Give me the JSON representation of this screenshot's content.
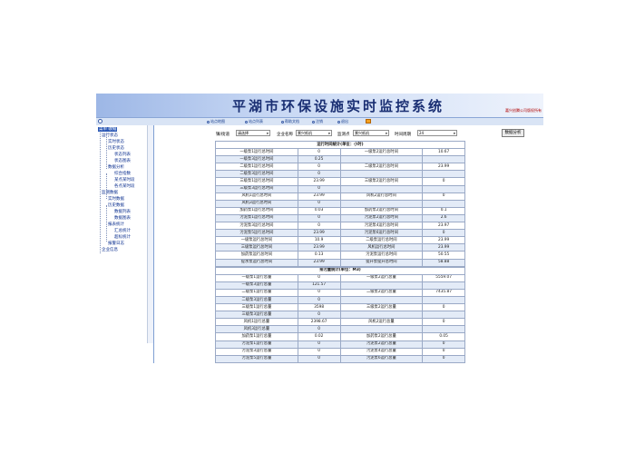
{
  "header": {
    "title": "平湖市环保设施实时监控系统",
    "copyright": "嘉兴创腾公司版权所有"
  },
  "toolbar": {
    "items": [
      "站点地图",
      "站点列表",
      "帮助文档",
      "注销",
      "退出"
    ]
  },
  "sidebar": {
    "items": [
      "菜单 收缩",
      "运行状态",
      "实时状态",
      "历史状态",
      "状态列表",
      "状态图表",
      "数据分析",
      "综合指数",
      "某点某时段",
      "各点某时段",
      "监测数据",
      "实时数据",
      "历史数据",
      "数据列表",
      "数据图表",
      "报表统计",
      "汇总统计",
      "超标统计",
      "报警日志",
      "企业信息"
    ]
  },
  "filters": {
    "town_label": "镇/街道",
    "town_value": "请选择",
    "company_label": "企业名称",
    "company_value": "景兴纸机",
    "point_label": "监测点",
    "point_value": "景兴纸机",
    "period_label": "时间周期",
    "period_value": "24",
    "analyze_button": "数据分析"
  },
  "runtime": {
    "caption": "运行时间统计(单位：小时)",
    "rows": [
      [
        "一级泵1运行总时间",
        "0",
        "一级泵2运行总时间",
        "10.67"
      ],
      [
        "一级泵3运行总时间",
        "0.25",
        "",
        ""
      ],
      [
        "二级泵1运行总时间",
        "0",
        "二级泵2运行总时间",
        "23.99"
      ],
      [
        "二级泵3运行总时间",
        "0",
        "",
        ""
      ],
      [
        "三级泵1运行总时间",
        "23.99",
        "三级泵2运行总时间",
        "0"
      ],
      [
        "三级泵3运行总时间",
        "0",
        "",
        ""
      ],
      [
        "风机1运行总时间",
        "23.99",
        "风机2运行总时间",
        "0"
      ],
      [
        "风机3运行总时间",
        "0",
        "",
        ""
      ],
      [
        "加药泵1运行总时间",
        "0.03",
        "加药泵2运行总时间",
        "0.1"
      ],
      [
        "污泥泵1运行总时间",
        "0",
        "污泥泵2运行总时间",
        "2.6"
      ],
      [
        "污泥泵3运行总时间",
        "0",
        "污泥泵4运行总时间",
        "23.97"
      ],
      [
        "污泥泵5运行总时间",
        "23.99",
        "污泥泵6运行总时间",
        "0"
      ],
      [
        "一级泵运行总时间",
        "10.9",
        "二级泵运行总时间",
        "23.99"
      ],
      [
        "三级泵运行总时间",
        "23.99",
        "风机运行总时间",
        "23.99"
      ],
      [
        "加药泵运行总时间",
        "0.13",
        "污泥泵运行总时间",
        "50.55"
      ],
      [
        "提水泵运行总时间",
        "23.99",
        "提升泵提升总时间",
        "58.88"
      ]
    ]
  },
  "discharge": {
    "caption": "排污量统计(单位：M3)",
    "rows": [
      [
        "一级泵1运行总量",
        "0",
        "一级泵2运行总量",
        "5559.07"
      ],
      [
        "一级泵3运行总量",
        "121.57",
        "",
        ""
      ],
      [
        "二级泵1运行总量",
        "0",
        "二级泵2运行总量",
        "7435.87"
      ],
      [
        "二级泵3运行总量",
        "0",
        "",
        ""
      ],
      [
        "三级泵1运行总量",
        "3598",
        "三级泵2运行总量",
        "0"
      ],
      [
        "三级泵3运行总量",
        "0",
        "",
        ""
      ],
      [
        "风机1运行总量",
        "2398.67",
        "风机2运行总量",
        "0"
      ],
      [
        "风机3运行总量",
        "0",
        "",
        ""
      ],
      [
        "加药泵1运行总量",
        "0.02",
        "加药泵2运行总量",
        "0.05"
      ],
      [
        "污泥泵1运行总量",
        "0",
        "污泥泵2运行总量",
        "0"
      ],
      [
        "污泥泵3运行总量",
        "0",
        "污泥泵4运行总量",
        "0"
      ],
      [
        "污泥泵5运行总量",
        "0",
        "污泥泵6运行总量",
        "0"
      ],
      [
        "一级泵运行总量",
        "5680.63",
        "二级泵运行总量",
        "7435.87"
      ],
      [
        "三级泵运行总量",
        "3598",
        "风机运行总量",
        "2398.67"
      ],
      [
        "加药泵运行总量",
        "0.07",
        "污泥泵运行总量",
        "0"
      ]
    ]
  }
}
